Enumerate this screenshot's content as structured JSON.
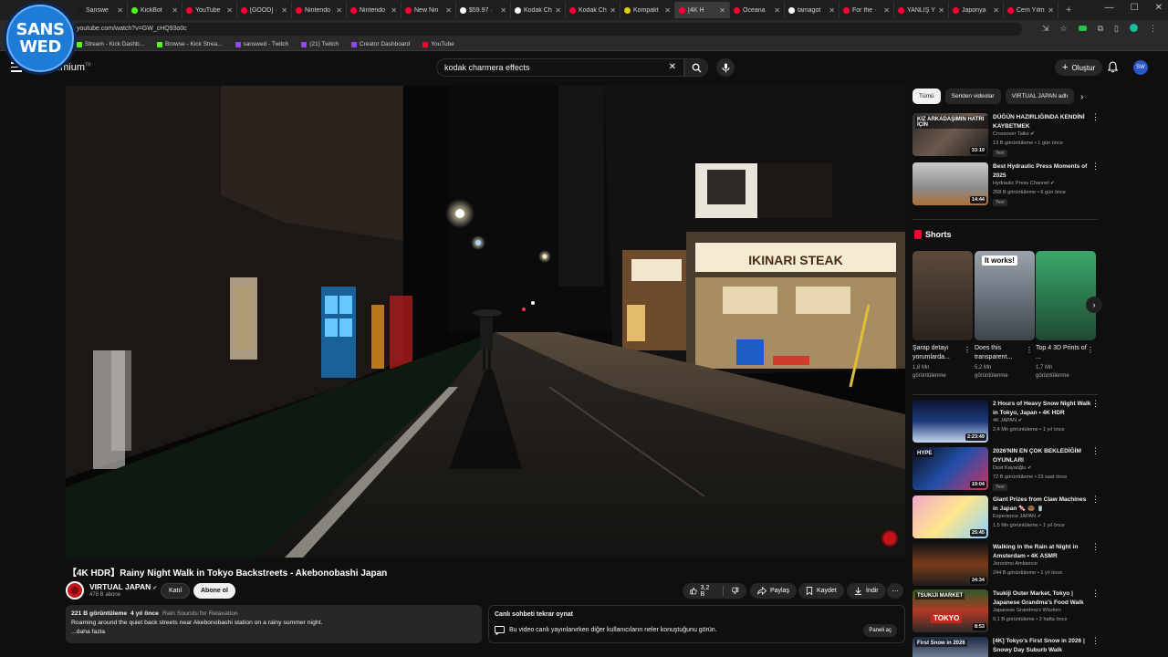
{
  "browser": {
    "tabs": [
      {
        "label": "Sanswe",
        "color": "#1d1d1d"
      },
      {
        "label": "KickBot",
        "color": "#53fc18"
      },
      {
        "label": "YouTube",
        "color": "#ff0033"
      },
      {
        "label": "[GOOD] ·",
        "color": "#ff0033"
      },
      {
        "label": "Nintendo",
        "color": "#ff0033"
      },
      {
        "label": "Nintendo",
        "color": "#ff0033"
      },
      {
        "label": "New Nin",
        "color": "#ff0033"
      },
      {
        "label": "$59.97 ·",
        "color": "#ffffff"
      },
      {
        "label": "Kodak Ch",
        "color": "#ffffff"
      },
      {
        "label": "Kodak Ch",
        "color": "#ff0033"
      },
      {
        "label": "Kompakt",
        "color": "#e3d000"
      },
      {
        "label": "[4K H",
        "color": "#ff0033",
        "active": true
      },
      {
        "label": "Oceana",
        "color": "#ff0033"
      },
      {
        "label": "tamagot",
        "color": "#ffffff"
      },
      {
        "label": "For the ·",
        "color": "#ff0033"
      },
      {
        "label": "YANLIŞ Y",
        "color": "#ff0033"
      },
      {
        "label": "Japonya",
        "color": "#ff0033"
      },
      {
        "label": "Cem Yılm",
        "color": "#ff0033"
      }
    ],
    "url": "youtube.com/watch?v=GW_cHQ93o0c",
    "bookmarks": [
      {
        "label": "Stream - Kick Dashb...",
        "color": "#53fc18"
      },
      {
        "label": "Browse - Kick Strea...",
        "color": "#53fc18"
      },
      {
        "label": "sanswed - Twitch",
        "color": "#9146ff"
      },
      {
        "label": "(21) Twitch",
        "color": "#9146ff"
      },
      {
        "label": "Creator Dashboard",
        "color": "#9146ff"
      },
      {
        "label": "YouTube",
        "color": "#ff0033"
      }
    ]
  },
  "overlay": {
    "line1": "SANS",
    "line2": "WED"
  },
  "header": {
    "logo_text": "emium",
    "logo_tm": "TR",
    "search_value": "kodak charmera effects",
    "create_label": "Oluştur",
    "avatar_text": "SW"
  },
  "video": {
    "title": "【4K HDR】Rainy Night Walk in Tokyo Backstreets - Akebonobashi Japan",
    "sign_ikinari": "IKINARI STEAK"
  },
  "channel": {
    "name": "VIRTUAL JAPAN",
    "verified": "✔",
    "subs": "478 B abone",
    "join_label": "Katıl",
    "subscribe_label": "Abone ol"
  },
  "actions": {
    "likes": "3,2 B",
    "share": "Paylaş",
    "save": "Kaydet",
    "download": "İndir"
  },
  "description": {
    "views": "221 B görüntüleme",
    "age": "4 yıl önce",
    "tag": "Rain Sounds for Relaxation",
    "text": "Roaming around the quiet back streets near Akebonobashi station on a rainy summer night.",
    "more": "...daha fazla"
  },
  "chat": {
    "title": "Canlı sohbeti tekrar oynat",
    "text": "Bu video canlı yayınlanırken diğer kullanıcıların neler konuştuğunu görün.",
    "button": "Paneli aç"
  },
  "sidebar": {
    "chips": [
      "Tümü",
      "Seriden videolar",
      "VIRTUAL JAPAN adlı"
    ],
    "recs_top": [
      {
        "title": "DÜĞÜN HAZIRLIĞINDA KENDİNİ KAYBETMEK",
        "channel": "Crossover Talks ✔",
        "meta": "13 B görüntüleme • 1 gün önce",
        "badge": "Yeni",
        "duration": "33:19",
        "thumb_text": "KIZ ARKADAŞIMIN HATRI İÇİN"
      },
      {
        "title": "Best Hydraulic Press Moments of 2025",
        "channel": "Hydraulic Press Channel ✔",
        "meta": "268 B görüntüleme • 6 gün önce",
        "badge": "Yeni",
        "duration": "14:44"
      }
    ],
    "shorts_title": "Shorts",
    "shorts": [
      {
        "title": "Şarap detayı yorumlarda...",
        "views": "1,8 Mn görüntülenme"
      },
      {
        "title": "Does this transparent...",
        "views": "5,2 Mn görüntülenme",
        "overlay": "It works!"
      },
      {
        "title": "Top 4 3D Prints of ...",
        "views": "1,7 Mn görüntülenme"
      }
    ],
    "recs_bottom": [
      {
        "title": "2 Hours of Heavy Snow Night Walk in Tokyo, Japan • 4K HDR",
        "channel": "4K JAPAN ✔",
        "meta": "2,4 Mn görüntüleme • 1 yıl önce",
        "duration": "2:23:49"
      },
      {
        "title": "2026'NIN EN ÇOK BEKLEDİĞİM OYUNLARI",
        "channel": "Dost Kayaoğlu ✔",
        "meta": "72 B görüntüleme • 23 saat önce",
        "badge": "Yeni",
        "duration": "19:04",
        "thumb_text": "HYPE"
      },
      {
        "title": "Giant Prizes from Claw Machines in Japan 🍬 🍩 🥤",
        "channel": "Experience JAPAN ✔",
        "meta": "1,5 Mn görüntüleme • 1 yıl önce",
        "duration": "25:45"
      },
      {
        "title": "Walking in the Rain at Night in Amsterdam • 4K ASMR",
        "channel": "Jeronimo Ambience",
        "meta": "244 B görüntüleme • 1 yıl önce",
        "duration": "34:34"
      },
      {
        "title": "Tsukiji Outer Market, Tokyo | Japanese Grandma's Food Walk",
        "channel": "Japanese Grandma's Wisdom",
        "meta": "9,1 B görüntüleme • 2 hafta önce",
        "duration": "8:53",
        "thumb_text": "TSUKIJI MARKET",
        "thumb_text2": "TOKYO"
      },
      {
        "title": "[4K] Tokyo's First Snow in 2026 | Snowy Day Suburb Walk",
        "channel": "",
        "meta": "",
        "duration": "",
        "thumb_text": "First Snow in 2026"
      }
    ]
  }
}
